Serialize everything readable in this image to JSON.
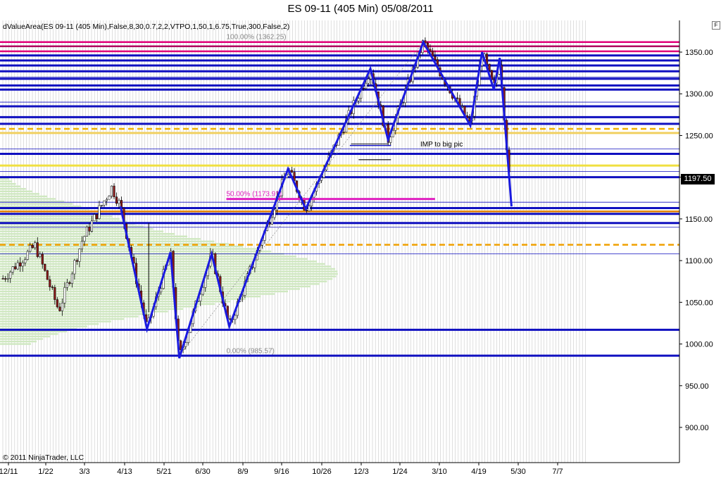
{
  "window": {
    "title": "ES 09-11 (405 Min)  05/08/2011",
    "indicator_label": "dValueArea(ES 09-11 (405 Min),False,8,30,0.7,2,2,VTPO,1,50,1,6.75,True,300,False,2)",
    "copyright": "© 2011 NinjaTrader, LLC",
    "f_button": "F",
    "last_price_tag": "1197.50"
  },
  "chart_data": {
    "type": "candlestick",
    "instrument": "ES 09-11",
    "x_tick_labels": [
      "12/11",
      "1/22",
      "3/3",
      "4/13",
      "5/21",
      "6/30",
      "8/9",
      "9/16",
      "10/26",
      "12/3",
      "1/24",
      "3/10",
      "4/19",
      "5/30",
      "7/7"
    ],
    "y_tick_labels": [
      "1350.00",
      "1300.00",
      "1250.00",
      "1200.00",
      "1150.00",
      "1100.00",
      "1050.00",
      "1000.00",
      "950.00",
      "900.00"
    ],
    "ylim": [
      858,
      1380
    ],
    "grid": "vertical",
    "last_price": 1197.5,
    "fib_levels": [
      {
        "label": "100.00% (1362.25)",
        "value": 1362.25
      },
      {
        "label": "50.00% (1173.91)",
        "value": 1173.91
      },
      {
        "label": "0.00% (985.57)",
        "value": 985.57
      }
    ],
    "annotations": [
      "IMP to big pic"
    ],
    "zigzag_points": [
      [
        0.205,
        1165
      ],
      [
        0.25,
        1018
      ],
      [
        0.29,
        1110
      ],
      [
        0.305,
        983
      ],
      [
        0.36,
        1108
      ],
      [
        0.39,
        1021
      ],
      [
        0.49,
        1210
      ],
      [
        0.52,
        1162
      ],
      [
        0.63,
        1330
      ],
      [
        0.66,
        1245
      ],
      [
        0.72,
        1362
      ],
      [
        0.8,
        1262
      ],
      [
        0.82,
        1350
      ],
      [
        0.84,
        1305
      ],
      [
        0.85,
        1343
      ],
      [
        0.87,
        1165
      ]
    ],
    "horizontal_levels": [
      {
        "value": 1362,
        "color": "#e0007a"
      },
      {
        "value": 1357,
        "color": "#b00060"
      },
      {
        "value": 1351,
        "color": "#e0007a"
      },
      {
        "value": 1346,
        "color": "#1010c0"
      },
      {
        "value": 1340,
        "color": "#1010c0"
      },
      {
        "value": 1334,
        "color": "#1010c0"
      },
      {
        "value": 1327,
        "color": "#1010c0"
      },
      {
        "value": 1318,
        "color": "#1010c0"
      },
      {
        "value": 1310,
        "color": "#1010c0"
      },
      {
        "value": 1305,
        "color": "#1010c0"
      },
      {
        "value": 1285,
        "color": "#1010c0"
      },
      {
        "value": 1272,
        "color": "#1010c0"
      },
      {
        "value": 1264,
        "color": "#1010c0"
      },
      {
        "value": 1258,
        "color": "#f0b000"
      },
      {
        "value": 1253,
        "color": "#f0d060"
      },
      {
        "value": 1228,
        "color": "#1010c0"
      },
      {
        "value": 1214,
        "color": "#f0e040"
      },
      {
        "value": 1200,
        "color": "#1010c0"
      },
      {
        "value": 1163,
        "color": "#1010c0"
      },
      {
        "value": 1159,
        "color": "#e08000"
      },
      {
        "value": 1156,
        "color": "#1010c0"
      },
      {
        "value": 1145,
        "color": "#1010c0"
      },
      {
        "value": 1119,
        "color": "#f0a000"
      },
      {
        "value": 1017,
        "color": "#1010c0"
      },
      {
        "value": 986,
        "color": "#1010c0"
      }
    ],
    "colors": {
      "zigzag": "#1a1ae0",
      "fib_50": "#e020c0",
      "volume_profile": "#cfe8c0",
      "price_tag_bg": "#000000",
      "grid": "#c8c8c8"
    }
  }
}
